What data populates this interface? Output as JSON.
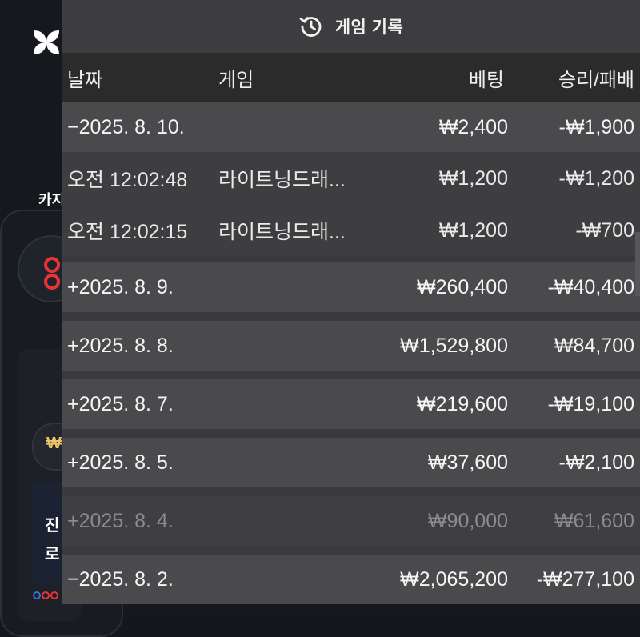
{
  "modal": {
    "title": "게임 기록",
    "icon": "history-icon"
  },
  "columns": {
    "date": "날짜",
    "game": "게임",
    "bet": "베팅",
    "win_loss": "승리/패배"
  },
  "rows": [
    {
      "toggle": "−",
      "date": "2025. 8. 10.",
      "game": "",
      "bet": "₩2,400",
      "win_loss": "-₩1,900",
      "expanded": true
    },
    {
      "time": "오전 12:02:48",
      "game": "라이트닝드래...",
      "bet": "₩1,200",
      "win_loss": "-₩1,200"
    },
    {
      "time": "오전 12:02:15",
      "game": "라이트닝드래...",
      "bet": "₩1,200",
      "win_loss": "-₩700"
    },
    {
      "toggle": "+",
      "date": "2025. 8. 9.",
      "game": "",
      "bet": "₩260,400",
      "win_loss": "-₩40,400"
    },
    {
      "toggle": "+",
      "date": "2025. 8. 8.",
      "game": "",
      "bet": "₩1,529,800",
      "win_loss": "₩84,700"
    },
    {
      "toggle": "+",
      "date": "2025. 8. 7.",
      "game": "",
      "bet": "₩219,600",
      "win_loss": "-₩19,100"
    },
    {
      "toggle": "+",
      "date": "2025. 8. 5.",
      "game": "",
      "bet": "₩37,600",
      "win_loss": "-₩2,100"
    },
    {
      "toggle": "+",
      "date": "2025. 8. 4.",
      "game": "",
      "bet": "₩90,000",
      "win_loss": "₩61,600"
    },
    {
      "toggle": "−",
      "date": "2025. 8. 2.",
      "game": "",
      "bet": "₩2,065,200",
      "win_loss": "-₩277,100"
    }
  ],
  "background": {
    "tab_label": "카지",
    "card_text_1": "진",
    "card_text_2": "로",
    "currency_symbol": "₩"
  },
  "colors": {
    "header_bg": "#3d3d3f",
    "row_bg": "#4a4a4d",
    "subrow_bg": "#3e3e41",
    "accent_red": "#e8333a"
  }
}
